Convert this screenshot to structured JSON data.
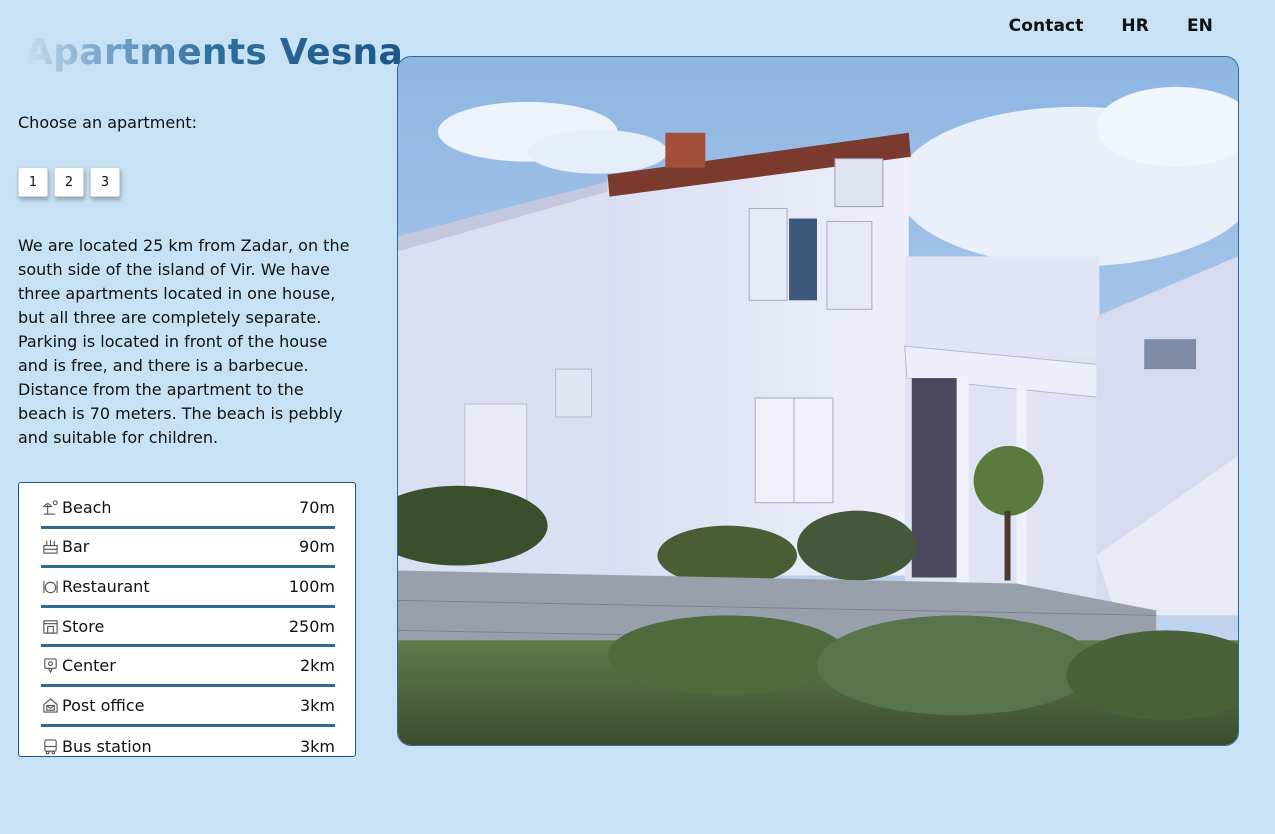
{
  "nav": {
    "contact": "Contact",
    "hr": "HR",
    "en": "EN"
  },
  "logo": "Apartments Vesna",
  "choose_label": "Choose an apartment:",
  "apartments": [
    "1",
    "2",
    "3"
  ],
  "description": "We are located 25 km from Zadar, on the south side of the island of Vir. We have three apartments located in one house, but all three are completely separate. Parking is located in front of the house and is free, and there is a barbecue. Distance from the apartment to the beach is 70 meters. The beach is pebbly and suitable for children.",
  "distances": [
    {
      "icon": "beach-umbrella-icon",
      "name": "Beach",
      "value": "70m"
    },
    {
      "icon": "bar-icon",
      "name": "Bar",
      "value": "90m"
    },
    {
      "icon": "restaurant-icon",
      "name": "Restaurant",
      "value": "100m"
    },
    {
      "icon": "store-icon",
      "name": "Store",
      "value": "250m"
    },
    {
      "icon": "map-pin-icon",
      "name": "Center",
      "value": "2km"
    },
    {
      "icon": "post-office-icon",
      "name": "Post office",
      "value": "3km"
    },
    {
      "icon": "bus-icon",
      "name": "Bus station",
      "value": "3km"
    }
  ],
  "colors": {
    "background": "#c7e2f4",
    "accent": "#1b5688",
    "divider": "#2e6a96"
  }
}
